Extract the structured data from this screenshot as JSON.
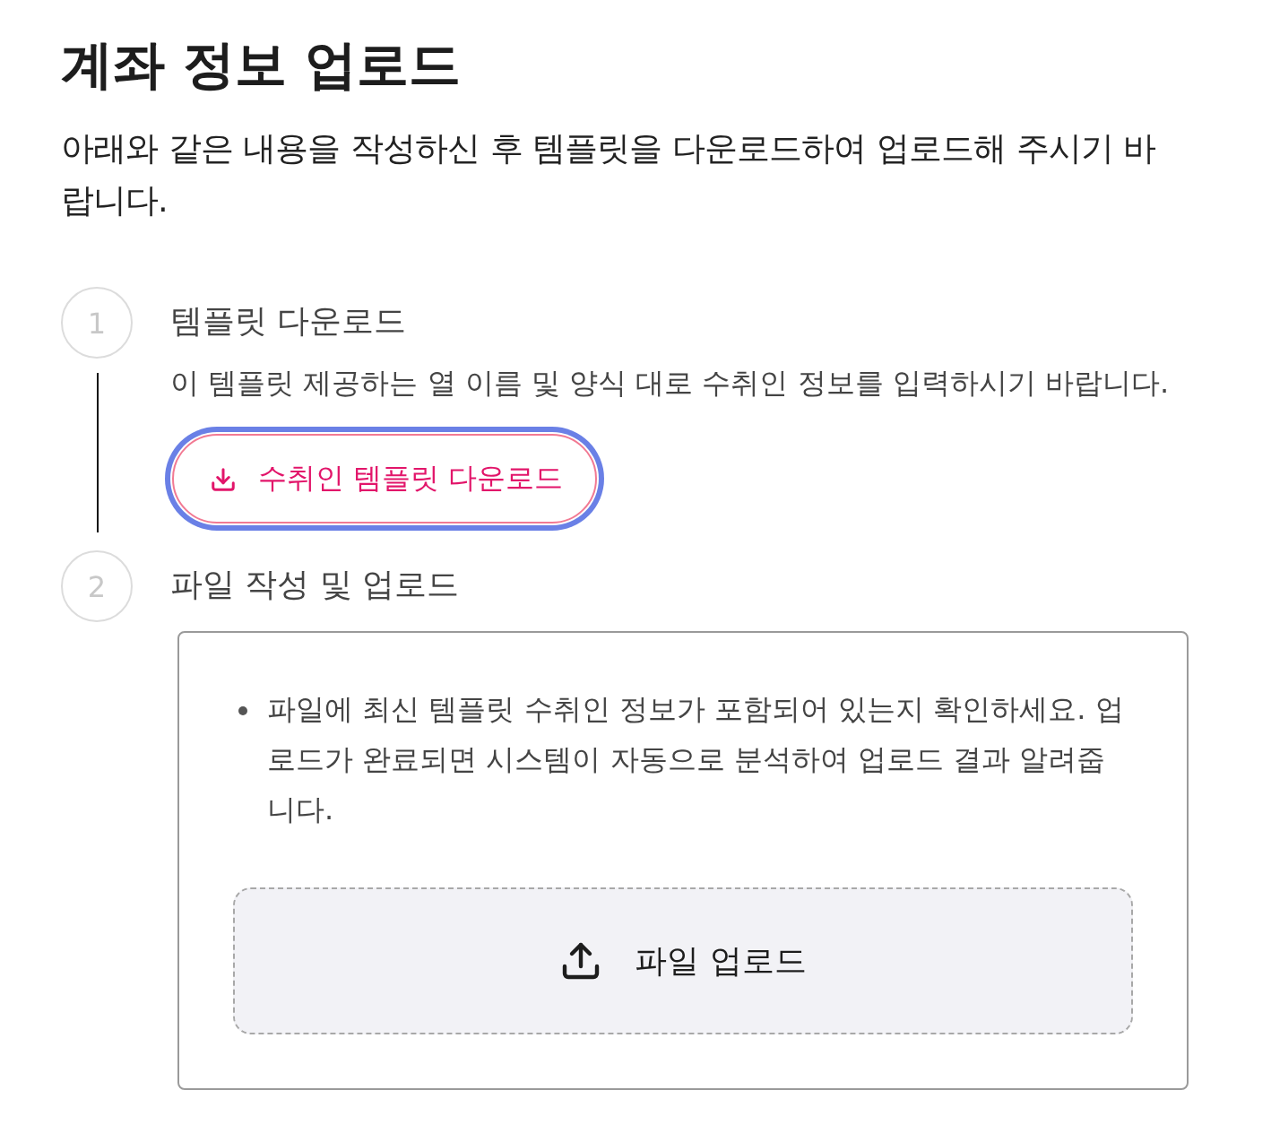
{
  "title": "계좌 정보 업로드",
  "description": "아래와 같은 내용을 작성하신 후 템플릿을 다운로드하여 업로드해 주시기 바랍니다.",
  "steps": [
    {
      "number": "1",
      "kind": "download",
      "title": "템플릿 다운로드",
      "description": "이 템플릿 제공하는 열 이름 및 양식 대로 수취인 정보를 입력하시기 바랍니다.",
      "button": {
        "label": "수취인 템플릿 다운로드",
        "focused": true
      }
    },
    {
      "number": "2",
      "kind": "upload",
      "title": "파일 작성 및 업로드",
      "notes": [
        "파일에 최신 템플릿 수취인 정보가 포함되어 있는지 확인하세요. 업로드가 완료되면 시스템이 자동으로 분석하여 업로드 결과 알려줍니다."
      ],
      "dropzone": {
        "label": "파일 업로드"
      }
    }
  ]
}
